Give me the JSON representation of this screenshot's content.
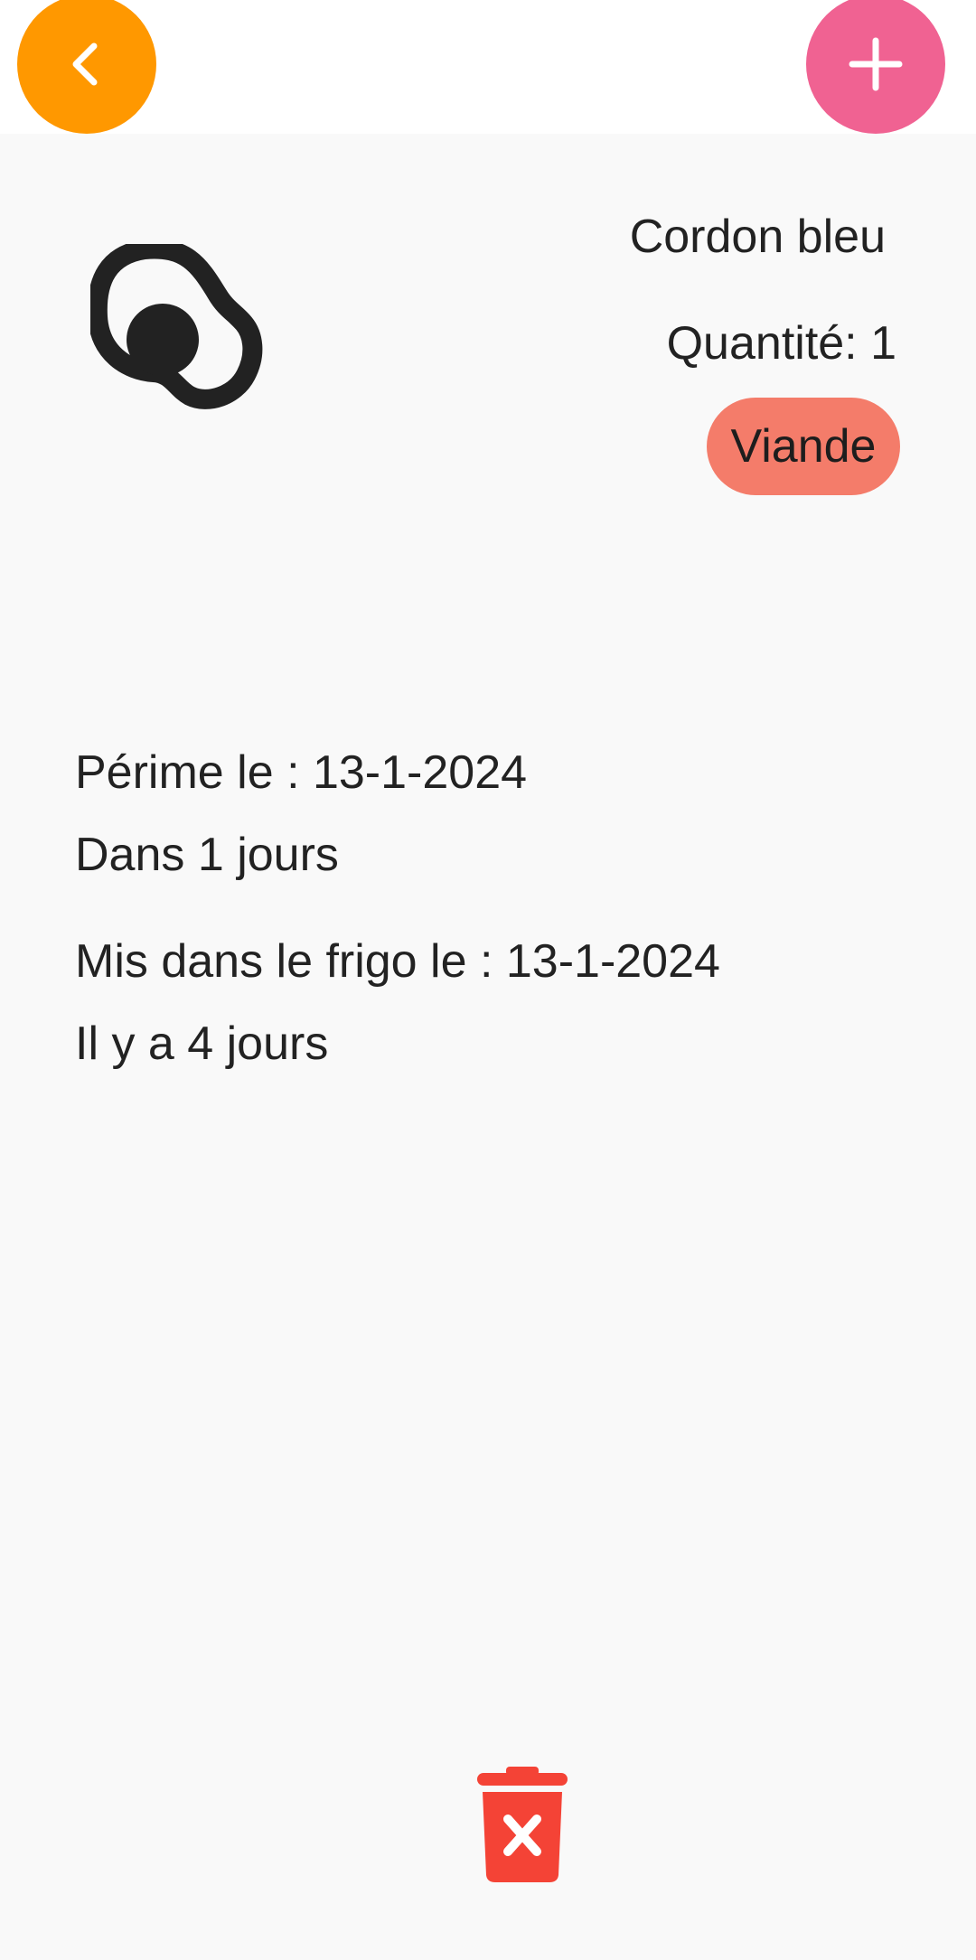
{
  "header": {
    "back_icon": "chevron-left-icon",
    "add_icon": "plus-icon"
  },
  "product": {
    "icon": "fried-egg-icon",
    "name": "Cordon bleu",
    "quantity": "Quantité: 1",
    "category": "Viande"
  },
  "dates": {
    "expire_label": "Périme le : 13-1-2024",
    "expire_relative": "Dans 1 jours",
    "added_label": "Mis dans le frigo le : 13-1-2024",
    "added_relative": "Il y a 4 jours"
  },
  "actions": {
    "delete_icon": "trash-delete-icon"
  },
  "colors": {
    "back_button": "#FF9800",
    "add_button": "#F06292",
    "category_badge": "#F47C6A",
    "delete_icon": "#F44336",
    "background": "#F9F9F9",
    "header_background": "#FFFFFF"
  }
}
